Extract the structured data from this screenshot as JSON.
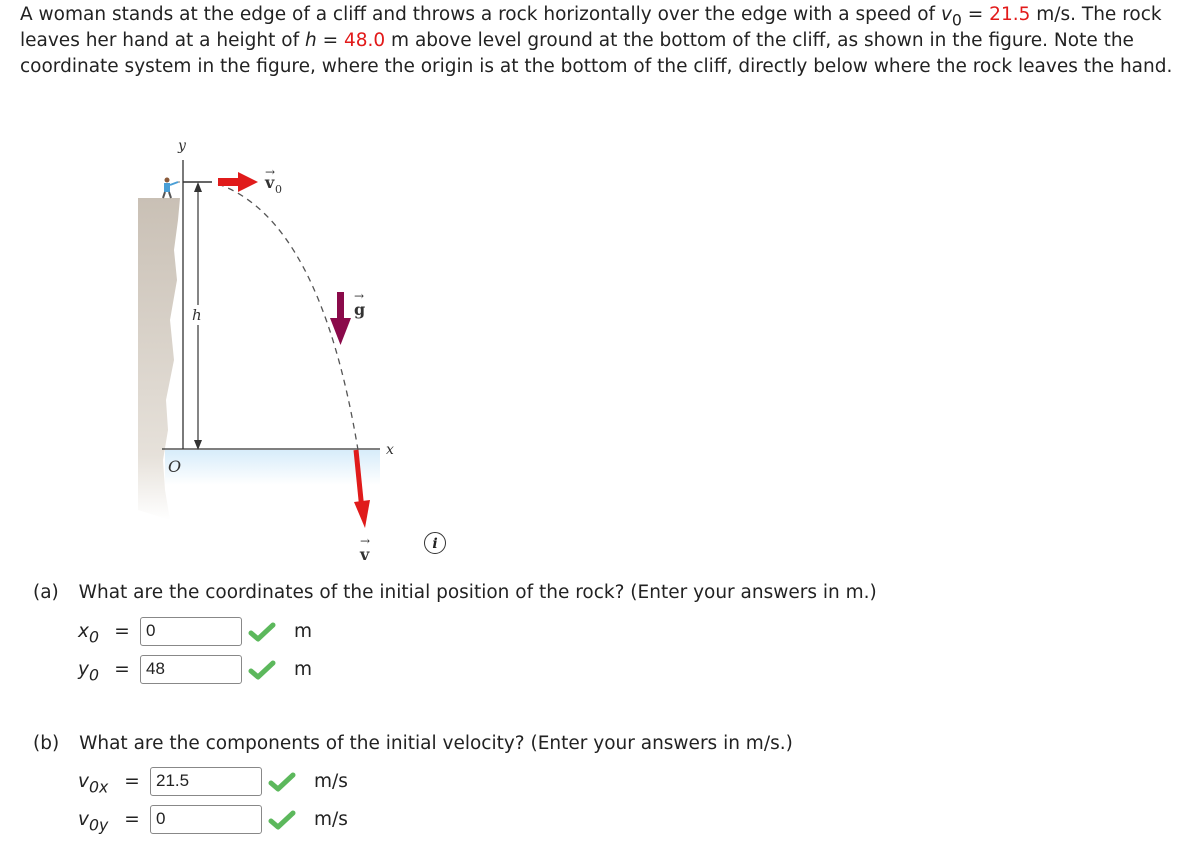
{
  "problem": {
    "p1": "A woman stands at the edge of a cliff and throws a rock horizontally over the edge with a speed of ",
    "v0_symbol": "v",
    "v0_sub": "0",
    "eq": " = ",
    "v0_value": "21.5",
    "p2": " m/s. The rock leaves her hand at a height of ",
    "h_symbol": "h",
    "h_value": "48.0",
    "p3": " m above level ground at the bottom of the cliff, as shown in the figure. Note the coordinate system in the figure, where the origin is at the bottom of the cliff, directly below where the rock leaves the hand."
  },
  "figure": {
    "y_label": "y",
    "x_label": "x",
    "origin_label": "O",
    "h_label": "h",
    "v0_label": "v",
    "v0_sub": "0",
    "g_label": "g",
    "v_label": "v",
    "colors": {
      "velocity": "#e01b1b",
      "gravity": "#8a0a4a",
      "cliff": "#c9c0b5",
      "ground": "#dcefff"
    }
  },
  "info_icon": "i",
  "part_a": {
    "label": "(a)",
    "question": "What are the coordinates of the initial position of the rock? (Enter your answers in m.)",
    "rows": [
      {
        "var": "x",
        "sub": "0",
        "eq": "=",
        "value": "0",
        "unit": "m",
        "status": "correct"
      },
      {
        "var": "y",
        "sub": "0",
        "eq": "=",
        "value": "48",
        "unit": "m",
        "status": "correct"
      }
    ]
  },
  "part_b": {
    "label": "(b)",
    "question": "What are the components of the initial velocity? (Enter your answers in m/s.)",
    "rows": [
      {
        "var": "v",
        "sub": "0x",
        "eq": "=",
        "value": "21.5",
        "unit": "m/s",
        "status": "correct"
      },
      {
        "var": "v",
        "sub": "0y",
        "eq": "=",
        "value": "0",
        "unit": "m/s",
        "status": "correct"
      }
    ]
  },
  "colors": {
    "check": "#5cb85c",
    "highlight": "#e21a1a"
  }
}
